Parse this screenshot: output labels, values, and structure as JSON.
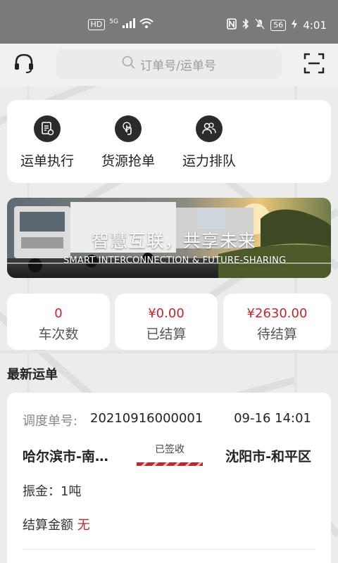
{
  "status_bar": {
    "hd": "HD",
    "network": "5G",
    "battery": "56",
    "time": "4:01"
  },
  "header": {
    "search_placeholder": "订单号/运单号"
  },
  "quick_actions": [
    {
      "label": "运单执行",
      "icon": "document-icon"
    },
    {
      "label": "货源抢单",
      "icon": "tap-hand-icon"
    },
    {
      "label": "运力排队",
      "icon": "users-icon"
    }
  ],
  "banner": {
    "title": "智慧互联，共享未来",
    "subtitle": "SMART INTERCONNECTION & FUTURE-SHARING"
  },
  "stats": [
    {
      "value": "0",
      "label": "车次数"
    },
    {
      "value": "¥0.00",
      "label": "已结算"
    },
    {
      "value": "¥2630.00",
      "label": "待结算"
    }
  ],
  "section_title": "最新运单",
  "order": {
    "dispatch_label": "调度单号:",
    "dispatch_no": "20210916000001",
    "time": "09-16 14:01",
    "from": "哈尔滨市-南…",
    "status": "已签收",
    "to": "沈阳市-和平区",
    "weight_text": "振金：1吨",
    "settle_label": "结算金额",
    "settle_value": "无"
  },
  "colors": {
    "accent_red": "#c0272d",
    "status_bar": "#7a7a7a"
  }
}
